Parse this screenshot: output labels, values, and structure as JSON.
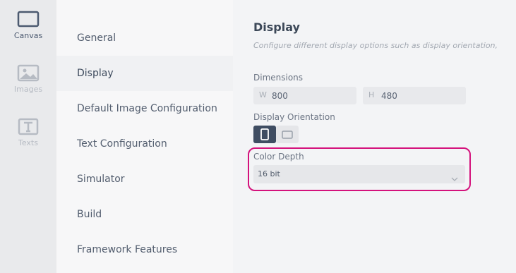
{
  "rail": {
    "items": [
      {
        "label": "Canvas",
        "icon": "canvas-icon",
        "active": true
      },
      {
        "label": "Images",
        "icon": "image-icon",
        "active": false
      },
      {
        "label": "Texts",
        "icon": "text-icon",
        "active": false
      }
    ]
  },
  "nav": {
    "items": [
      {
        "label": "General"
      },
      {
        "label": "Display",
        "active": true
      },
      {
        "label": "Default Image Configuration"
      },
      {
        "label": "Text Configuration"
      },
      {
        "label": "Simulator"
      },
      {
        "label": "Build"
      },
      {
        "label": "Framework Features"
      }
    ]
  },
  "main": {
    "title": "Display",
    "subtitle": "Configure different display options such as display orientation,",
    "dimensions": {
      "label": "Dimensions",
      "width_prefix": "W",
      "width_value": "800",
      "height_prefix": "H",
      "height_value": "480"
    },
    "orientation": {
      "label": "Display Orientation",
      "selected": "portrait"
    },
    "color_depth": {
      "label": "Color Depth",
      "value": "16 bit"
    }
  },
  "colors": {
    "highlight": "#d4127c",
    "accent": "#3f4d62"
  }
}
